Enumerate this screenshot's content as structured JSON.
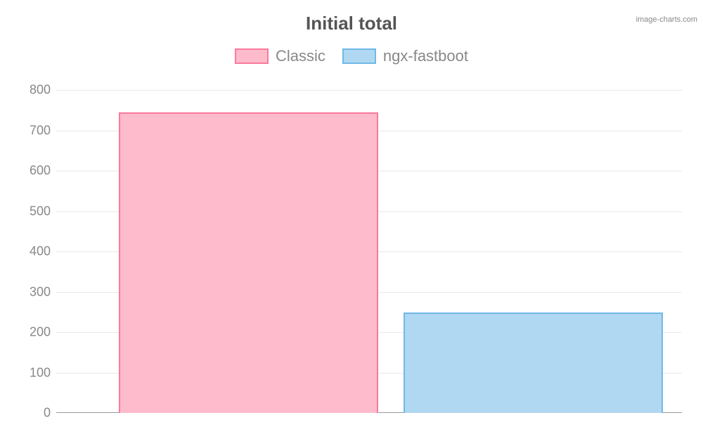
{
  "watermark": "image-charts.com",
  "chart_data": {
    "type": "bar",
    "title": "Initial total",
    "xlabel": "",
    "ylabel": "",
    "ylim": [
      0,
      800
    ],
    "yticks": [
      0,
      100,
      200,
      300,
      400,
      500,
      600,
      700,
      800
    ],
    "categories": [
      "Classic",
      "ngx-fastboot"
    ],
    "series": [
      {
        "name": "Classic",
        "values": [
          745
        ],
        "fill": "#febbcc",
        "stroke": "#fa7a9a"
      },
      {
        "name": "ngx-fastboot",
        "values": [
          248
        ],
        "fill": "#b1d8f2",
        "stroke": "#6fb9e6"
      }
    ],
    "legend_position": "top"
  }
}
